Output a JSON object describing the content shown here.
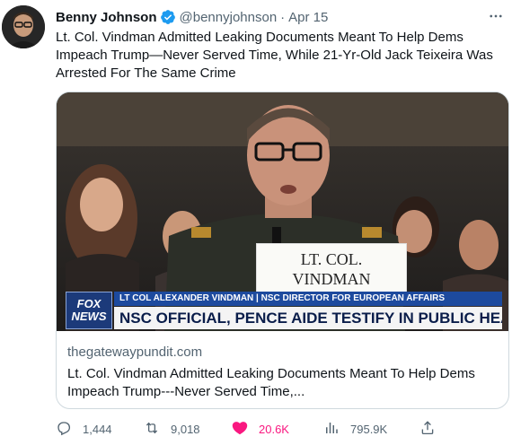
{
  "author": {
    "name": "Benny Johnson",
    "handle": "@bennyjohnson",
    "separator": "·",
    "date": "Apr 15"
  },
  "tweet_text": "Lt. Col. Vindman Admitted Leaking Documents Meant To Help Dems Impeach Trump—Never Served Time, While 21-Yr-Old Jack Teixeira Was Arrested For The Same Crime",
  "link_card": {
    "media_overlay": {
      "network_logo_top": "FOX",
      "network_logo_bottom": "NEWS",
      "chyron_top": "LT COL ALEXANDER VINDMAN | NSC DIRECTOR FOR EUROPEAN AFFAIRS",
      "chyron_main": "NSC OFFICIAL, PENCE AIDE TESTIFY IN PUBLIC HEARING",
      "nameplate_line1": "LT. COL.",
      "nameplate_line2": "VINDMAN"
    },
    "domain": "thegatewaypundit.com",
    "title": "Lt. Col. Vindman Admitted Leaking Documents Meant To Help Dems Impeach Trump---Never Served Time,..."
  },
  "actions": {
    "replies": "1,444",
    "retweets": "9,018",
    "likes": "20.6K",
    "views": "795.9K"
  },
  "colors": {
    "like_active": "#f91880",
    "verified": "#1d9bf0",
    "secondary_text": "#536471"
  },
  "icons": [
    "verified-badge-icon",
    "more-icon",
    "reply-icon",
    "retweet-icon",
    "heart-icon",
    "views-icon",
    "share-icon"
  ]
}
